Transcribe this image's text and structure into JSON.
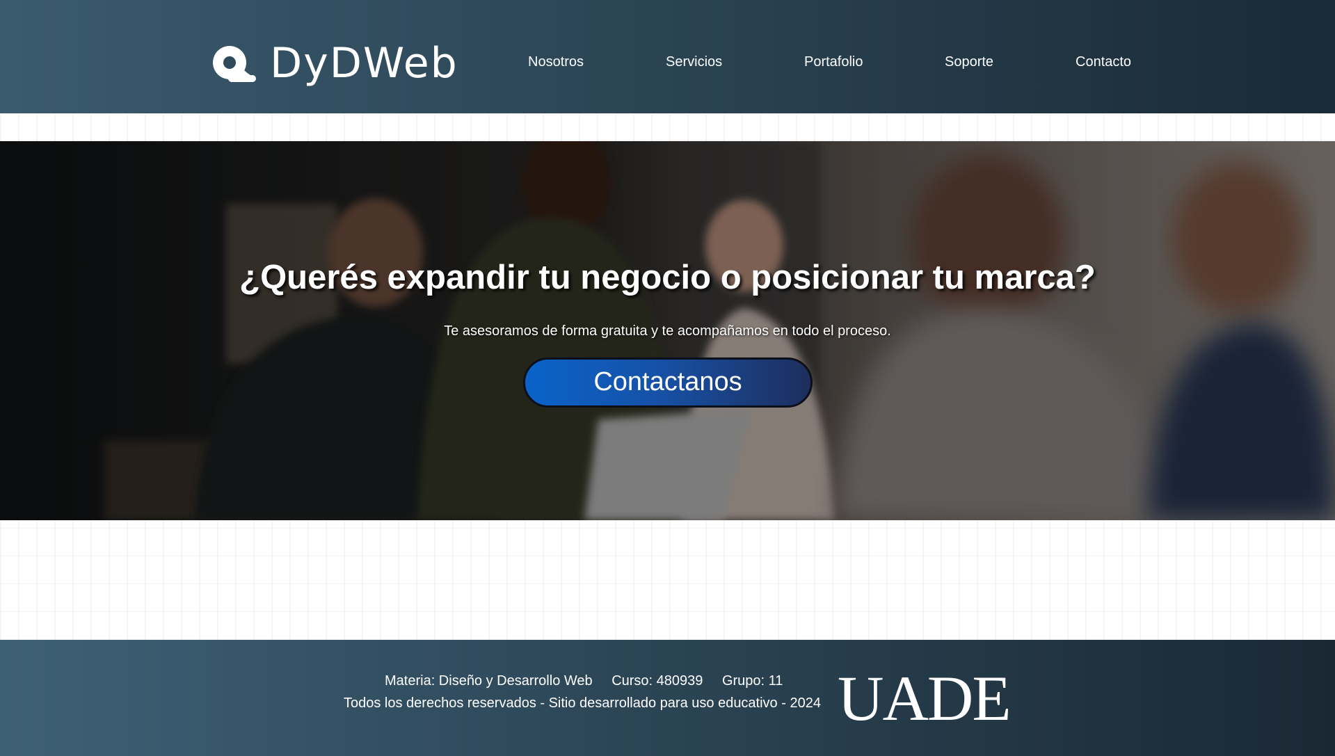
{
  "brand": {
    "name": "DyDWeb",
    "logo_icon": "swirl-logo-icon"
  },
  "nav": {
    "items": [
      {
        "label": "Nosotros"
      },
      {
        "label": "Servicios"
      },
      {
        "label": "Portafolio"
      },
      {
        "label": "Soporte"
      },
      {
        "label": "Contacto"
      }
    ]
  },
  "hero": {
    "title": "¿Querés expandir tu negocio o posicionar tu marca?",
    "subtitle": "Te asesoramos de forma gratuita y te acompañamos en todo el proceso.",
    "cta_label": "Contactanos"
  },
  "footer": {
    "materia": "Materia: Diseño y Desarrollo Web",
    "curso": "Curso: 480939",
    "grupo": "Grupo: 11",
    "rights": "Todos los derechos reservados - Sitio desarrollado para uso educativo - 2024",
    "university_logo": "UADE"
  },
  "colors": {
    "header_start": "#3a5a6e",
    "header_end": "#1a2a36",
    "cta_start": "#0a63c9",
    "cta_end": "#1e2e5c"
  }
}
